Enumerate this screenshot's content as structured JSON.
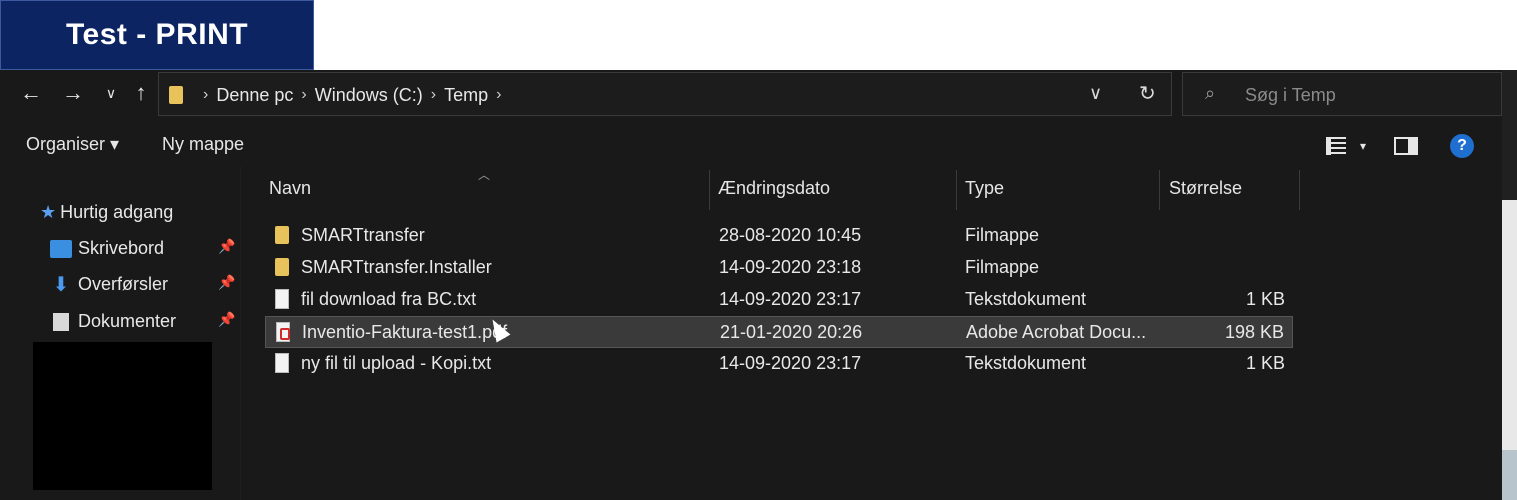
{
  "banner": {
    "text": "Test - PRINT"
  },
  "address_bar": {
    "breadcrumbs": [
      "Denne pc",
      "Windows (C:)",
      "Temp"
    ],
    "search_placeholder": "Søg i Temp"
  },
  "command_bar": {
    "organise_label": "Organiser ▾",
    "new_folder_label": "Ny mappe"
  },
  "nav_pane": {
    "quick_access": "Hurtig adgang",
    "items": [
      {
        "label": "Skrivebord",
        "icon": "desktop-icon"
      },
      {
        "label": "Overførsler",
        "icon": "download-icon"
      },
      {
        "label": "Dokumenter",
        "icon": "documents-icon"
      }
    ]
  },
  "file_list": {
    "columns": [
      "Navn",
      "Ændringsdato",
      "Type",
      "Størrelse"
    ],
    "rows": [
      {
        "name": "SMARTtransfer",
        "date": "28-08-2020 10:45",
        "type": "Filmappe",
        "size": "",
        "icon": "folder-icon"
      },
      {
        "name": "SMARTtransfer.Installer",
        "date": "14-09-2020 23:18",
        "type": "Filmappe",
        "size": "",
        "icon": "folder-icon"
      },
      {
        "name": "fil download fra BC.txt",
        "date": "14-09-2020 23:17",
        "type": "Tekstdokument",
        "size": "1 KB",
        "icon": "text-file-icon"
      },
      {
        "name": "Inventio-Faktura-test1.pdf",
        "date": "21-01-2020 20:26",
        "type": "Adobe Acrobat Docu...",
        "size": "198 KB",
        "icon": "pdf-file-icon",
        "selected": true
      },
      {
        "name": "ny fil til upload - Kopi.txt",
        "date": "14-09-2020 23:17",
        "type": "Tekstdokument",
        "size": "1 KB",
        "icon": "text-file-icon"
      }
    ]
  },
  "colors": {
    "banner_bg": "#0c2461",
    "window_bg": "#191919",
    "selection_bg": "#3a3a3a",
    "folder": "#e8c25a",
    "accent": "#3b8fe0"
  }
}
